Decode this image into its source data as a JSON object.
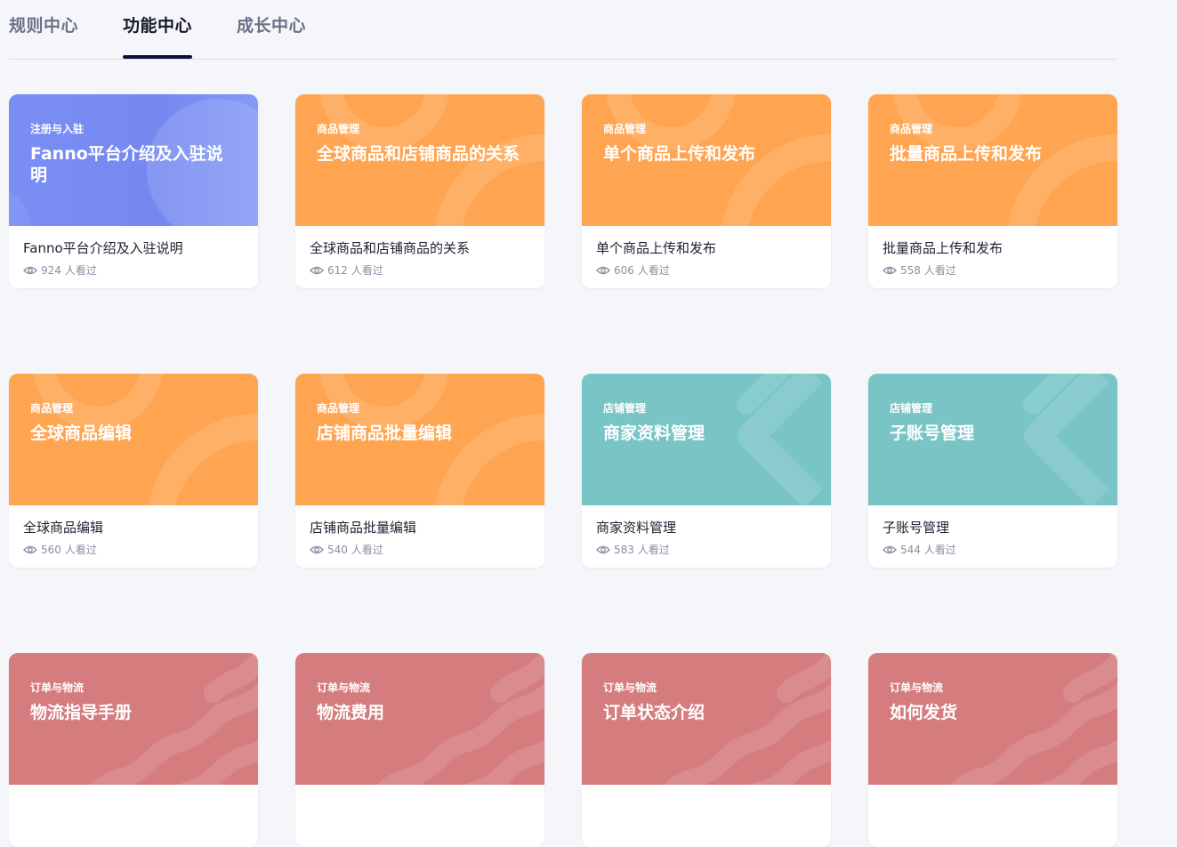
{
  "tabs": [
    {
      "label": "规则中心",
      "active": false
    },
    {
      "label": "功能中心",
      "active": true
    },
    {
      "label": "成长中心",
      "active": false
    }
  ],
  "cards": [
    {
      "category": "注册与入驻",
      "banner_title": "Fanno平台介绍及入驻说明",
      "title": "Fanno平台介绍及入驻说明",
      "views": "924 人看过",
      "theme": "blue"
    },
    {
      "category": "商品管理",
      "banner_title": "全球商品和店铺商品的关系",
      "title": "全球商品和店铺商品的关系",
      "views": "612 人看过",
      "theme": "orange"
    },
    {
      "category": "商品管理",
      "banner_title": "单个商品上传和发布",
      "title": "单个商品上传和发布",
      "views": "606 人看过",
      "theme": "orange"
    },
    {
      "category": "商品管理",
      "banner_title": "批量商品上传和发布",
      "title": "批量商品上传和发布",
      "views": "558 人看过",
      "theme": "orange"
    },
    {
      "category": "商品管理",
      "banner_title": "全球商品编辑",
      "title": "全球商品编辑",
      "views": "560 人看过",
      "theme": "orange"
    },
    {
      "category": "商品管理",
      "banner_title": "店铺商品批量编辑",
      "title": "店铺商品批量编辑",
      "views": "540 人看过",
      "theme": "orange"
    },
    {
      "category": "店铺管理",
      "banner_title": "商家资料管理",
      "title": "商家资料管理",
      "views": "583 人看过",
      "theme": "teal"
    },
    {
      "category": "店铺管理",
      "banner_title": "子账号管理",
      "title": "子账号管理",
      "views": "544 人看过",
      "theme": "teal"
    },
    {
      "category": "订单与物流",
      "banner_title": "物流指导手册",
      "title": "",
      "views": "",
      "theme": "rose"
    },
    {
      "category": "订单与物流",
      "banner_title": "物流费用",
      "title": "",
      "views": "",
      "theme": "rose"
    },
    {
      "category": "订单与物流",
      "banner_title": "订单状态介绍",
      "title": "",
      "views": "",
      "theme": "rose"
    },
    {
      "category": "订单与物流",
      "banner_title": "如何发货",
      "title": "",
      "views": "",
      "theme": "rose"
    }
  ],
  "colors": {
    "blue": "#7a8ef5",
    "orange": "#ffa552",
    "teal": "#79c5c6",
    "rose": "#d57c7f",
    "active_tab": "#16182a",
    "inactive_tab": "#6c7088",
    "underline": "#0c0f3a"
  },
  "icons": {
    "views": "eye-icon"
  }
}
